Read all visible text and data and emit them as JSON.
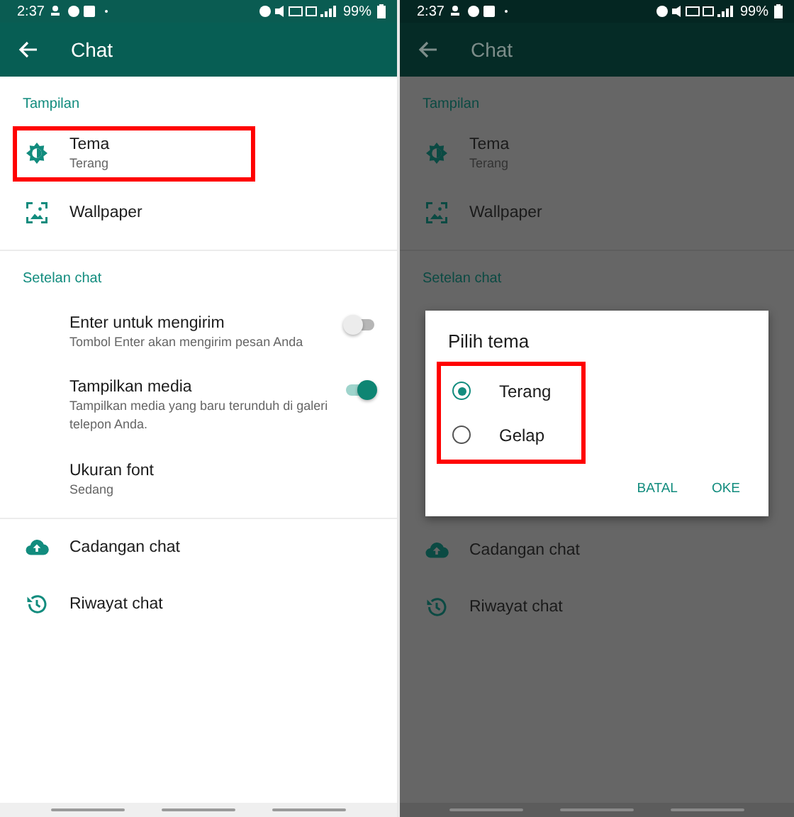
{
  "screens": [
    {
      "dimmed": false,
      "status_bar": {
        "time": "2:37",
        "battery": "99%"
      },
      "app_bar": {
        "title": "Chat"
      },
      "sections": [
        {
          "header": "Tampilan",
          "items": [
            {
              "kind": "theme",
              "title": "Tema",
              "subtitle": "Terang",
              "highlighted": true
            },
            {
              "kind": "wallpaper",
              "title": "Wallpaper"
            }
          ]
        },
        {
          "header": "Setelan chat",
          "items": [
            {
              "kind": "toggle",
              "title": "Enter untuk mengirim",
              "subtitle": "Tombol Enter akan mengirim pesan Anda",
              "on": false
            },
            {
              "kind": "toggle",
              "title": "Tampilkan media",
              "subtitle": "Tampilkan media yang baru terunduh di galeri telepon Anda.",
              "on": true
            },
            {
              "kind": "plain",
              "title": "Ukuran font",
              "subtitle": "Sedang"
            }
          ]
        },
        {
          "items": [
            {
              "kind": "backup",
              "title": "Cadangan chat"
            },
            {
              "kind": "history",
              "title": "Riwayat chat"
            }
          ]
        }
      ]
    },
    {
      "dimmed": true,
      "status_bar": {
        "time": "2:37",
        "battery": "99%"
      },
      "app_bar": {
        "title": "Chat"
      },
      "sections": [
        {
          "header": "Tampilan",
          "items": [
            {
              "kind": "theme",
              "title": "Tema",
              "subtitle": "Terang"
            },
            {
              "kind": "wallpaper",
              "title": "Wallpaper"
            }
          ]
        },
        {
          "header": "Setelan chat",
          "dialog": {
            "title": "Pilih tema",
            "highlighted": true,
            "options": [
              {
                "label": "Terang",
                "selected": true
              },
              {
                "label": "Gelap",
                "selected": false
              }
            ],
            "buttons": [
              "BATAL",
              "OKE"
            ]
          }
        },
        {
          "items": [
            {
              "kind": "backup",
              "title": "Cadangan chat"
            },
            {
              "kind": "history",
              "title": "Riwayat chat"
            }
          ]
        }
      ]
    }
  ]
}
